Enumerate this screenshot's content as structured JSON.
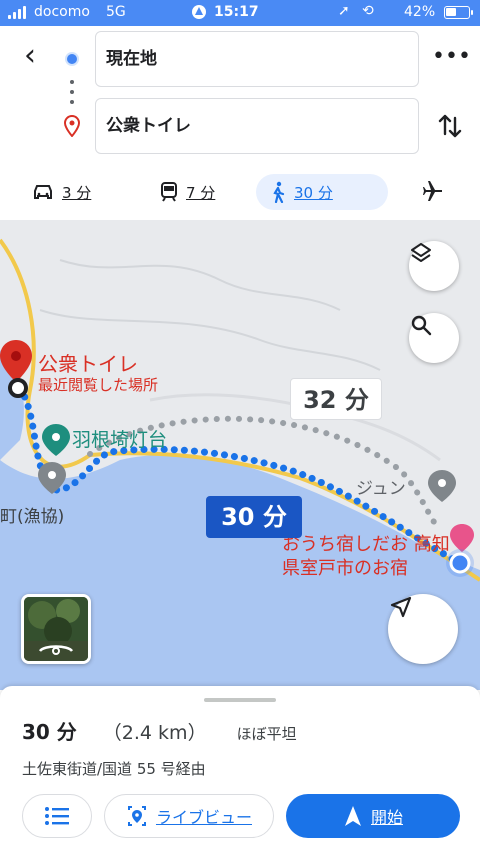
{
  "status_bar": {
    "carrier": "docomo",
    "network": "5G",
    "time": "15:17",
    "battery": "42%"
  },
  "header": {
    "origin": "現在地",
    "destination": "公衆トイレ",
    "modes": [
      {
        "name": "car",
        "label": "3 分"
      },
      {
        "name": "train",
        "label": "7 分"
      },
      {
        "name": "walk",
        "label": "30 分",
        "active": true
      },
      {
        "name": "flight",
        "label": ""
      }
    ]
  },
  "map": {
    "destination_title": "公衆トイレ",
    "destination_subtitle": "最近閲覧した場所",
    "lighthouse": "羽根埼灯台",
    "fishery": "町(漁協)",
    "poi_jun": "ジュン",
    "inn_line1": "おうち宿しだお 高知",
    "inn_line2": "県室戸市のお宿",
    "alt_route_time": "32 分",
    "main_route_time": "30 分",
    "colors": {
      "route": "#4285f4",
      "destination_pin": "#d93025",
      "alt_route": "#9aa0a6"
    }
  },
  "sheet": {
    "duration": "30 分",
    "distance": "（2.4 km）",
    "terrain": "ほぼ平坦",
    "via": "土佐東街道/国道 55 号経由",
    "steps_icon": "list-icon",
    "live_view_label": "ライブビュー",
    "start_label": "開始"
  }
}
